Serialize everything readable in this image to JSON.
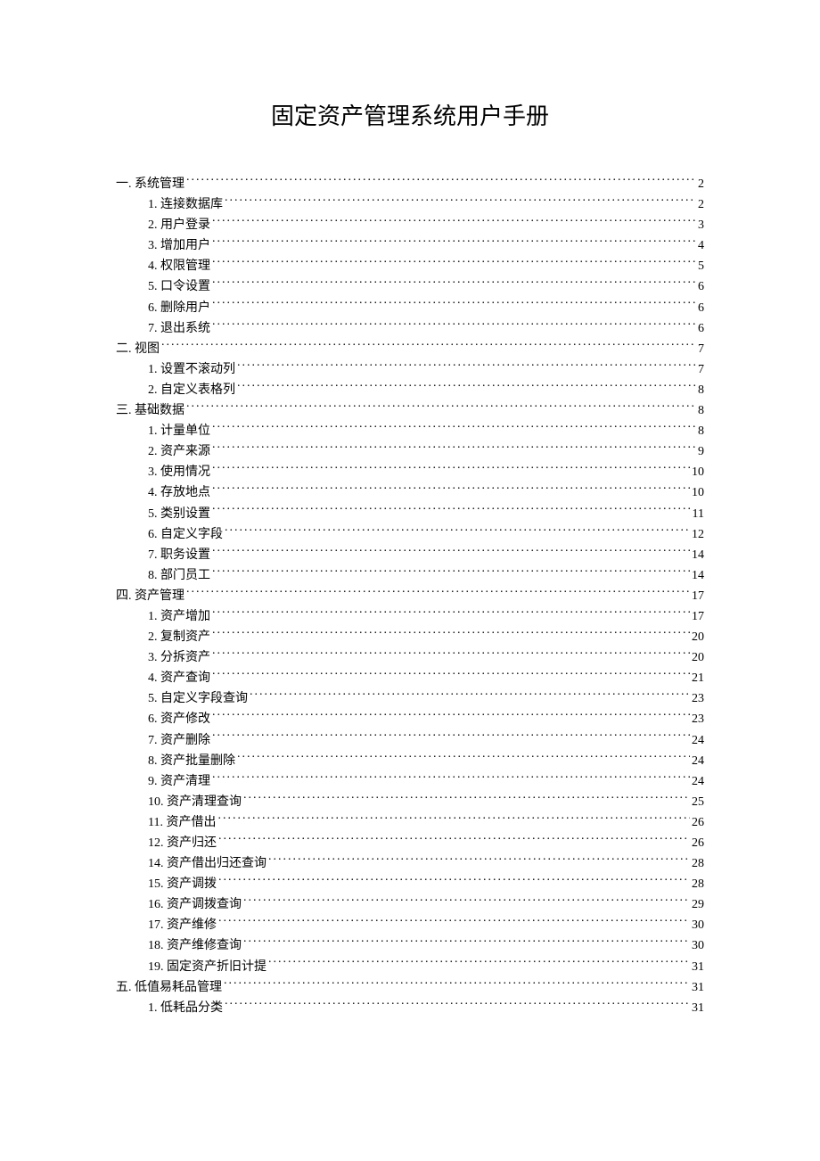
{
  "title": "固定资产管理系统用户手册",
  "toc": [
    {
      "level": 1,
      "label": "一. 系统管理",
      "page": "2"
    },
    {
      "level": 2,
      "label": "1. 连接数据库",
      "page": "2"
    },
    {
      "level": 2,
      "label": "2. 用户登录",
      "page": "3"
    },
    {
      "level": 2,
      "label": "3. 增加用户",
      "page": "4"
    },
    {
      "level": 2,
      "label": "4. 权限管理",
      "page": "5"
    },
    {
      "level": 2,
      "label": "5. 口令设置",
      "page": "6"
    },
    {
      "level": 2,
      "label": "6. 删除用户",
      "page": "6"
    },
    {
      "level": 2,
      "label": "7. 退出系统",
      "page": "6"
    },
    {
      "level": 1,
      "label": "二. 视图",
      "page": "7"
    },
    {
      "level": 2,
      "label": "1. 设置不滚动列",
      "page": "7"
    },
    {
      "level": 2,
      "label": "2. 自定义表格列",
      "page": "8"
    },
    {
      "level": 1,
      "label": "三. 基础数据",
      "page": "8"
    },
    {
      "level": 2,
      "label": "1. 计量单位",
      "page": "8"
    },
    {
      "level": 2,
      "label": "2. 资产来源",
      "page": "9"
    },
    {
      "level": 2,
      "label": "3. 使用情况",
      "page": "10"
    },
    {
      "level": 2,
      "label": "4. 存放地点",
      "page": "10"
    },
    {
      "level": 2,
      "label": "5. 类别设置",
      "page": "11"
    },
    {
      "level": 2,
      "label": "6. 自定义字段",
      "page": "12"
    },
    {
      "level": 2,
      "label": "7. 职务设置",
      "page": "14"
    },
    {
      "level": 2,
      "label": "8. 部门员工",
      "page": "14"
    },
    {
      "level": 1,
      "label": "四. 资产管理",
      "page": "17"
    },
    {
      "level": 2,
      "label": "1. 资产增加",
      "page": "17"
    },
    {
      "level": 2,
      "label": "2. 复制资产",
      "page": "20"
    },
    {
      "level": 2,
      "label": "3. 分拆资产",
      "page": "20"
    },
    {
      "level": 2,
      "label": "4. 资产查询",
      "page": "21"
    },
    {
      "level": 2,
      "label": "5. 自定义字段查询",
      "page": "23"
    },
    {
      "level": 2,
      "label": "6. 资产修改",
      "page": "23"
    },
    {
      "level": 2,
      "label": "7. 资产删除",
      "page": "24"
    },
    {
      "level": 2,
      "label": "8. 资产批量删除",
      "page": "24"
    },
    {
      "level": 2,
      "label": "9. 资产清理",
      "page": "24"
    },
    {
      "level": 2,
      "label": "10. 资产清理查询",
      "page": "25"
    },
    {
      "level": 2,
      "label": "11. 资产借出",
      "page": "26"
    },
    {
      "level": 2,
      "label": "12. 资产归还",
      "page": "26"
    },
    {
      "level": 2,
      "label": "14. 资产借出归还查询",
      "page": "28"
    },
    {
      "level": 2,
      "label": "15. 资产调拨",
      "page": "28"
    },
    {
      "level": 2,
      "label": "16. 资产调拨查询",
      "page": "29"
    },
    {
      "level": 2,
      "label": "17. 资产维修",
      "page": "30"
    },
    {
      "level": 2,
      "label": "18. 资产维修查询",
      "page": "30"
    },
    {
      "level": 2,
      "label": "19. 固定资产折旧计提",
      "page": "31"
    },
    {
      "level": 1,
      "label": "五. 低值易耗品管理",
      "page": "31"
    },
    {
      "level": 2,
      "label": "1. 低耗品分类",
      "page": "31"
    }
  ]
}
